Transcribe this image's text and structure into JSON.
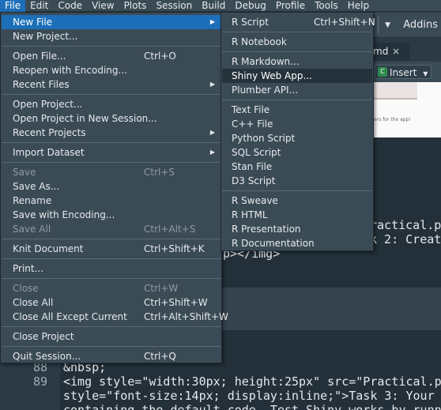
{
  "menubar": {
    "items": [
      "File",
      "Edit",
      "Code",
      "View",
      "Plots",
      "Session",
      "Build",
      "Debug",
      "Profile",
      "Tools",
      "Help"
    ]
  },
  "toolbar": {
    "addins_label": "Addins"
  },
  "editor_tab": {
    "label": "md",
    "close": "×"
  },
  "editor_toolbar": {
    "insert_label": "Insert",
    "insert_icon": "C"
  },
  "preview": {
    "snippet": "ers for the app!"
  },
  "file_menu": {
    "items": [
      {
        "label": "New File",
        "shortcut": "",
        "submenu": true,
        "disabled": false
      },
      {
        "label": "New Project...",
        "shortcut": "",
        "submenu": false,
        "disabled": false
      },
      {
        "label": "Open File...",
        "shortcut": "Ctrl+O",
        "submenu": false,
        "disabled": false
      },
      {
        "label": "Reopen with Encoding...",
        "shortcut": "",
        "submenu": false,
        "disabled": false
      },
      {
        "label": "Recent Files",
        "shortcut": "",
        "submenu": true,
        "disabled": false
      },
      {
        "label": "Open Project...",
        "shortcut": "",
        "submenu": false,
        "disabled": false
      },
      {
        "label": "Open Project in New Session...",
        "shortcut": "",
        "submenu": false,
        "disabled": false
      },
      {
        "label": "Recent Projects",
        "shortcut": "",
        "submenu": true,
        "disabled": false
      },
      {
        "label": "Import Dataset",
        "shortcut": "",
        "submenu": true,
        "disabled": false
      },
      {
        "label": "Save",
        "shortcut": "Ctrl+S",
        "submenu": false,
        "disabled": true
      },
      {
        "label": "Save As...",
        "shortcut": "",
        "submenu": false,
        "disabled": false
      },
      {
        "label": "Rename",
        "shortcut": "",
        "submenu": false,
        "disabled": false
      },
      {
        "label": "Save with Encoding...",
        "shortcut": "",
        "submenu": false,
        "disabled": false
      },
      {
        "label": "Save All",
        "shortcut": "Ctrl+Alt+S",
        "submenu": false,
        "disabled": true
      },
      {
        "label": "Knit Document",
        "shortcut": "Ctrl+Shift+K",
        "submenu": false,
        "disabled": false
      },
      {
        "label": "Print...",
        "shortcut": "",
        "submenu": false,
        "disabled": false
      },
      {
        "label": "Close",
        "shortcut": "Ctrl+W",
        "submenu": false,
        "disabled": true
      },
      {
        "label": "Close All",
        "shortcut": "Ctrl+Shift+W",
        "submenu": false,
        "disabled": false
      },
      {
        "label": "Close All Except Current",
        "shortcut": "Ctrl+Alt+Shift+W",
        "submenu": false,
        "disabled": false
      },
      {
        "label": "Close Project",
        "shortcut": "",
        "submenu": false,
        "disabled": false
      },
      {
        "label": "Quit Session...",
        "shortcut": "Ctrl+Q",
        "submenu": false,
        "disabled": false
      }
    ]
  },
  "new_file_submenu": {
    "items": [
      {
        "label": "R Script",
        "shortcut": "Ctrl+Shift+N"
      },
      {
        "label": "R Notebook",
        "shortcut": ""
      },
      {
        "label": "R Markdown...",
        "shortcut": ""
      },
      {
        "label": "Shiny Web App...",
        "shortcut": ""
      },
      {
        "label": "Plumber API...",
        "shortcut": ""
      },
      {
        "label": "Text File",
        "shortcut": ""
      },
      {
        "label": "C++ File",
        "shortcut": ""
      },
      {
        "label": "Python Script",
        "shortcut": ""
      },
      {
        "label": "SQL Script",
        "shortcut": ""
      },
      {
        "label": "Stan File",
        "shortcut": ""
      },
      {
        "label": "D3 Script",
        "shortcut": ""
      },
      {
        "label": "R Sweave",
        "shortcut": ""
      },
      {
        "label": "R HTML",
        "shortcut": ""
      },
      {
        "label": "R Presentation",
        "shortcut": ""
      },
      {
        "label": "R Documentation",
        "shortcut": ""
      }
    ]
  },
  "editor": {
    "partial_lines": [
      "ractical.p",
      "k 2: Creat",
      "p></img>"
    ],
    "lines": [
      {
        "num": "88",
        "text": "&nbsp;"
      },
      {
        "num": "89",
        "text": "<img style=\"width:30px; height:25px\" src=\"Practical.p"
      },
      {
        "num": "",
        "text": "style=\"font-size:14px; display:inline;\">Task 3: Your"
      },
      {
        "num": "",
        "text": "containing the default code. Test Shiny works by runn"
      }
    ]
  }
}
